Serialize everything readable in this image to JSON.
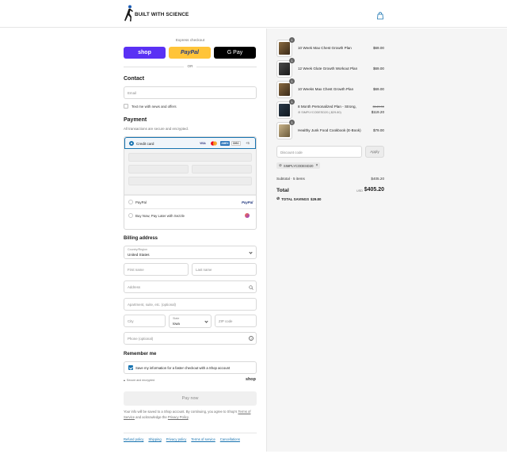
{
  "header": {
    "brand": "BUILT WITH SCIENCE",
    "logo_icon": "runner-logo-icon",
    "cart_icon": "shopping-bag-icon"
  },
  "express": {
    "label": "Express checkout",
    "shop": "shop",
    "paypal": "PayPal",
    "gpay": "G Pay",
    "or": "OR"
  },
  "contact": {
    "title": "Contact",
    "email_placeholder": "Email",
    "newsletter_label": "Text me with news and offers"
  },
  "payment": {
    "title": "Payment",
    "subtitle": "All transactions are secure and encrypted.",
    "credit_card_label": "Credit card",
    "card_brands": [
      "VISA",
      "MC",
      "AMEX",
      "DISC"
    ],
    "more_cards": "+5",
    "paypal_label": "PayPal",
    "paypal_logo": "PayPal",
    "sezzle_label": "Buy Now, Pay Later with Sezzle"
  },
  "billing": {
    "title": "Billing address",
    "country_label": "Country/Region",
    "country_value": "United States",
    "first_name": "First name",
    "last_name": "Last name",
    "address": "Address",
    "apartment": "Apartment, suite, etc. (optional)",
    "city": "City",
    "state_label": "State",
    "state_value": "Iowa",
    "zip": "ZIP code",
    "phone": "Phone (optional)"
  },
  "remember": {
    "title": "Remember me",
    "save_label": "Save my information for a faster checkout with a Shop account",
    "secure_label": "Secure and encrypted",
    "shop_logo": "shop"
  },
  "pay_now": "Pay now",
  "info": {
    "line1": "Your info will be saved to a Shop account. By continuing, you agree to Shop's",
    "terms": "Terms of Service",
    "middle": " and acknowledge the ",
    "privacy": "Privacy Policy",
    "end": "."
  },
  "footer_links": [
    "Refund policy",
    "Shipping",
    "Privacy policy",
    "Terms of service",
    "Cancellations"
  ],
  "cart": {
    "items": [
      {
        "name": "10 Week Max Chest Growth Plan",
        "price": "$69.00",
        "qty": "1"
      },
      {
        "name": "12 Week Glute Growth Workout Plan",
        "price": "$69.00",
        "qty": "1"
      },
      {
        "name": "10 Weeks Max Chest Growth Plan",
        "price": "$69.00",
        "qty": "1"
      },
      {
        "name": "8 Month Personalized Plan - Strong,",
        "price": "$119.20",
        "original_price": "$149.00",
        "discount_note": "SIMPLYCODESD20 (-$29.80)",
        "qty": "1"
      },
      {
        "name": "Healthy Junk Food Cookbook (E-Book)",
        "price": "$79.00",
        "qty": "1"
      }
    ],
    "discount_placeholder": "Discount code",
    "apply": "Apply",
    "applied_code": "SIMPLYCODESD20",
    "subtotal_label": "Subtotal · 5 items",
    "subtotal_value": "$405.20",
    "total_label": "Total",
    "currency": "USD",
    "total_value": "$405.20",
    "savings_label": "TOTAL SAVINGS",
    "savings_value": "$29.80"
  },
  "colors": {
    "shop_purple": "#5a31f4",
    "paypal_yellow": "#ffc439",
    "accent_blue": "#1773b0"
  }
}
